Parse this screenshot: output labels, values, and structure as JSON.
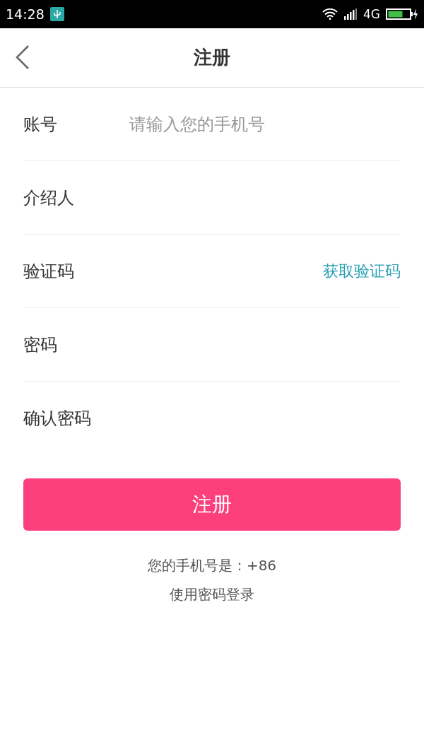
{
  "status_bar": {
    "time": "14:28",
    "network": "4G"
  },
  "header": {
    "title": "注册"
  },
  "fields": [
    {
      "label": "账号",
      "placeholder": "请输入您的手机号"
    },
    {
      "label": "介绍人"
    },
    {
      "label": "验证码",
      "action": "获取验证码"
    },
    {
      "label": "密码"
    },
    {
      "label": "确认密码"
    }
  ],
  "submit_button": "注册",
  "phone_note": "您的手机号是：+86",
  "password_login_link": "使用密码登录"
}
